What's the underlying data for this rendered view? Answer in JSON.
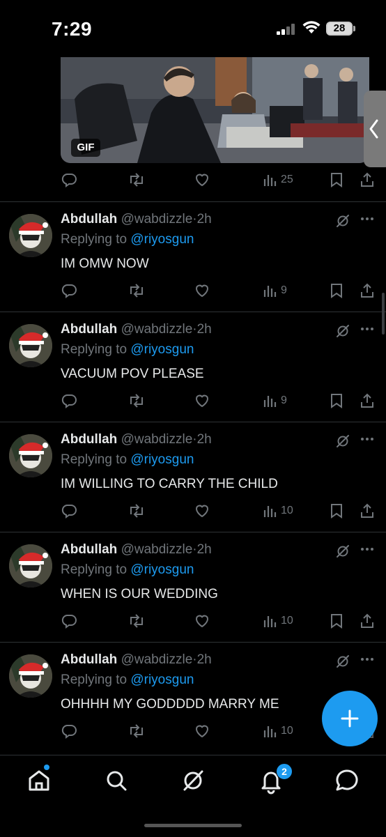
{
  "status_bar": {
    "time": "7:29",
    "battery": "28"
  },
  "media": {
    "badge": "GIF"
  },
  "top_actions": {
    "views": "25"
  },
  "tweets": [
    {
      "name": "Abdullah",
      "handle": "@wabdizzle",
      "dot": "·",
      "time": "2h",
      "replying_label": "Replying to",
      "mention": "@riyosgun",
      "text": "IM OMW NOW",
      "views": "9"
    },
    {
      "name": "Abdullah",
      "handle": "@wabdizzle",
      "dot": "·",
      "time": "2h",
      "replying_label": "Replying to",
      "mention": "@riyosgun",
      "text": "VACUUM POV PLEASE",
      "views": "9"
    },
    {
      "name": "Abdullah",
      "handle": "@wabdizzle",
      "dot": "·",
      "time": "2h",
      "replying_label": "Replying to",
      "mention": "@riyosgun",
      "text": "IM WILLING TO CARRY THE CHILD",
      "views": "10"
    },
    {
      "name": "Abdullah",
      "handle": "@wabdizzle",
      "dot": "·",
      "time": "2h",
      "replying_label": "Replying to",
      "mention": "@riyosgun",
      "text": "WHEN IS OUR WEDDING",
      "views": "10"
    },
    {
      "name": "Abdullah",
      "handle": "@wabdizzle",
      "dot": "·",
      "time": "2h",
      "replying_label": "Replying to",
      "mention": "@riyosgun",
      "text": "OHHHH MY GODDDDD MARRY ME",
      "views": "10"
    }
  ],
  "nav": {
    "notifications_badge": "2"
  },
  "icons": [
    "reply-icon",
    "retweet-icon",
    "like-icon",
    "views-icon",
    "bookmark-icon",
    "share-icon",
    "grok-icon",
    "more-icon",
    "home-icon",
    "search-icon",
    "notifications-icon",
    "messages-icon",
    "compose-icon"
  ],
  "colors": {
    "background": "#000000",
    "text": "#e7e9ea",
    "muted": "#71767b",
    "accent": "#1d9bf0",
    "divider": "#2f3336"
  }
}
